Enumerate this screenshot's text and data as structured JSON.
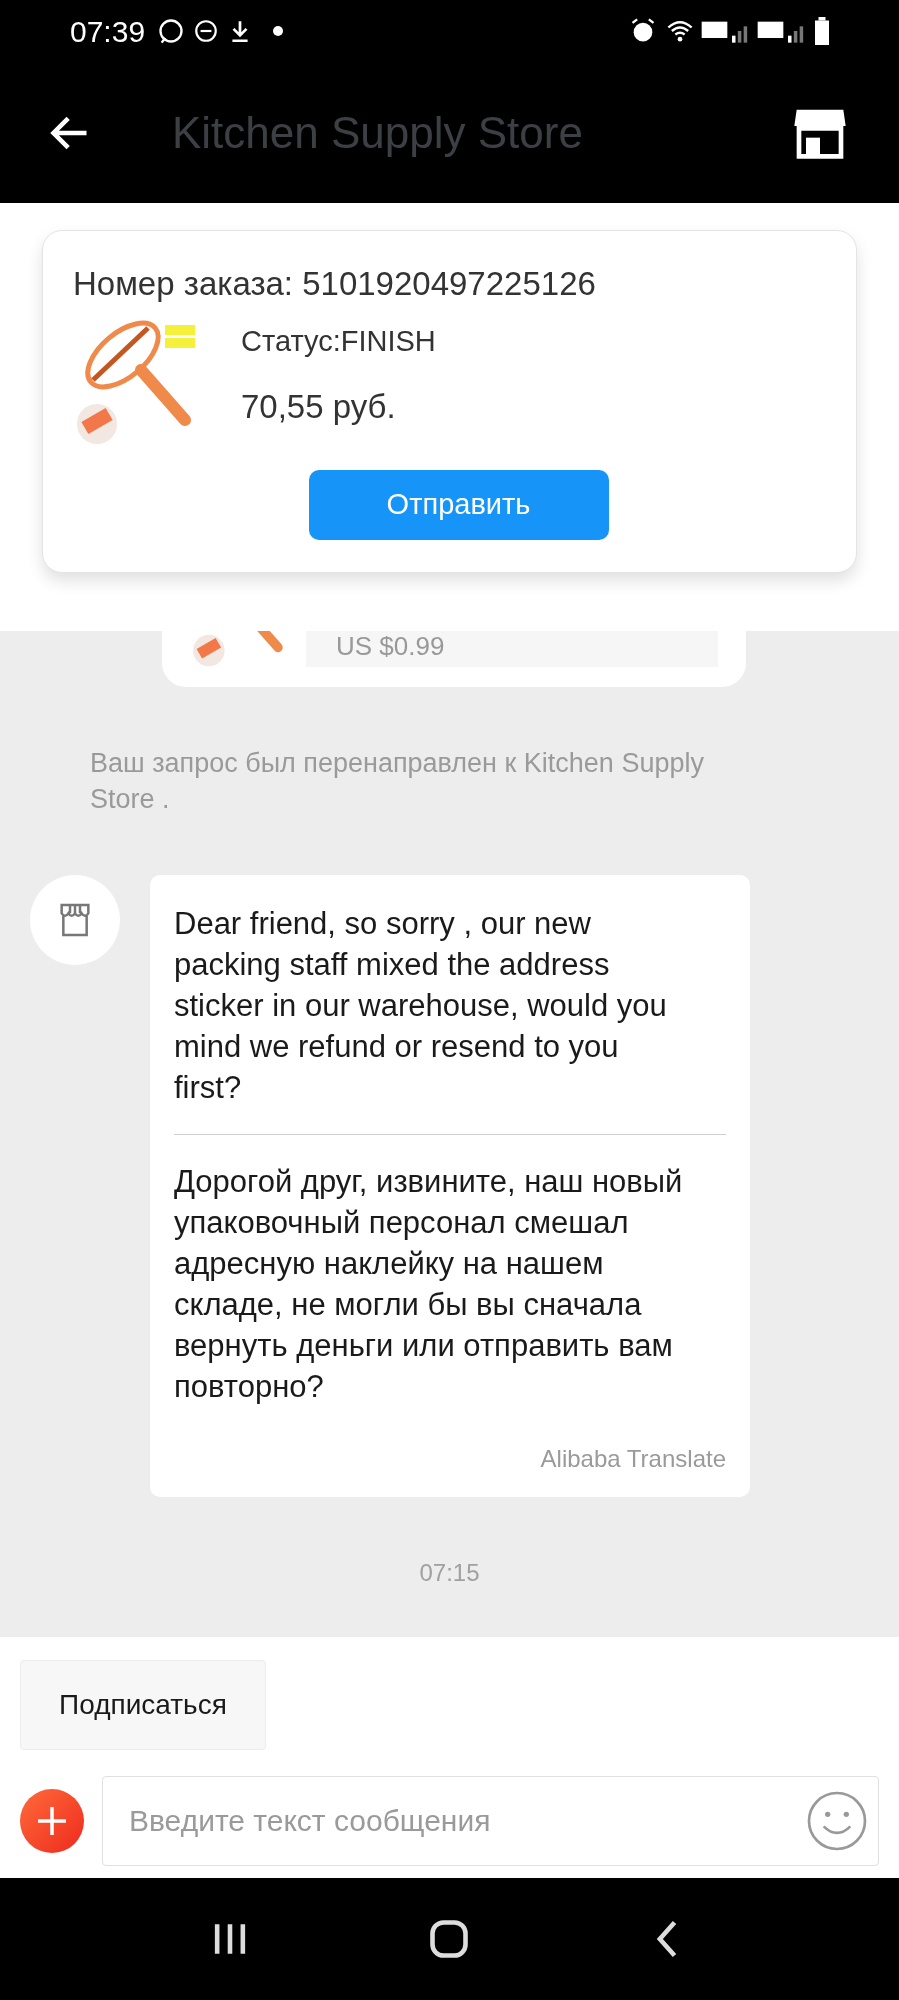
{
  "status_bar": {
    "time": "07:39"
  },
  "header": {
    "title": "Kitchen Supply Store"
  },
  "order_card": {
    "order_number": "Номер заказа: 5101920497225126",
    "status": "Статус:FINISH",
    "price": "70,55 руб.",
    "button": "Отправить"
  },
  "previous_message": {
    "price": "US $0.99"
  },
  "system_message": "Ваш запрос был перенаправлен к Kitchen Supply Store .",
  "message": {
    "original": "Dear friend, so sorry , our new packing staff mixed the address sticker in our warehouse, would you mind we refund or resend to you first?",
    "translation": "Дорогой друг, извините, наш новый упаковочный персонал смешал адресную наклейку на нашем складе, не могли бы вы сначала вернуть деньги или отправить вам повторно?",
    "translator": "Alibaba Translate"
  },
  "timestamp": "07:15",
  "subscribe_button": "Подписаться",
  "composer": {
    "placeholder": "Введите текст сообщения"
  }
}
